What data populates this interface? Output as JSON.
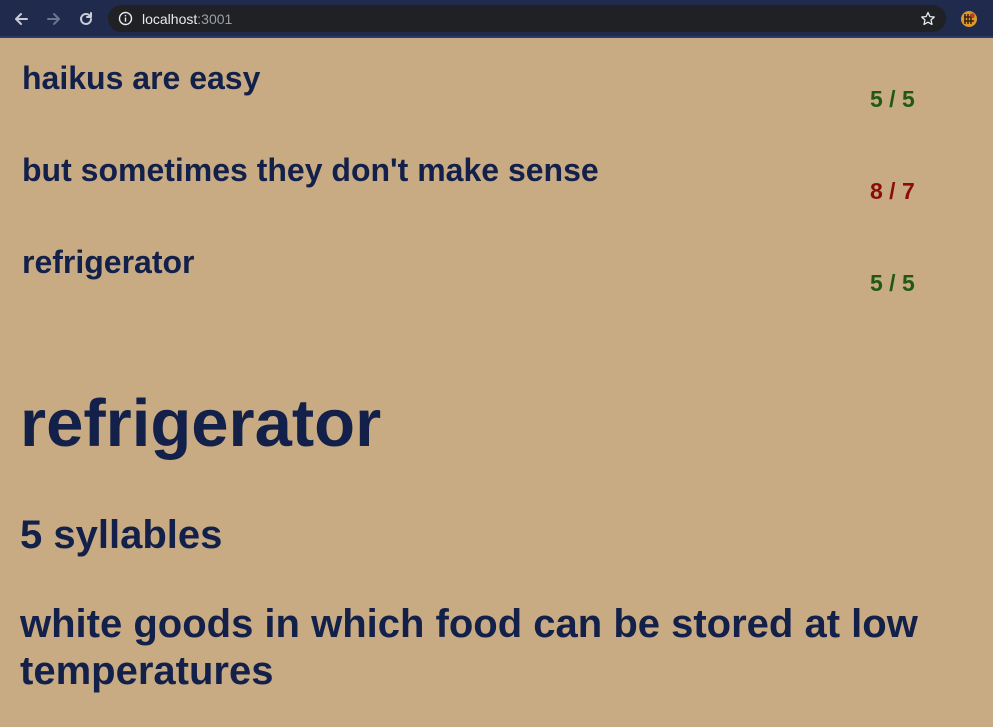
{
  "browser": {
    "url_host": "localhost",
    "url_port": ":3001",
    "icons": [
      "back-arrow-icon",
      "forward-arrow-icon",
      "reload-icon",
      "info-icon",
      "star-icon",
      "extension-icon"
    ]
  },
  "haiku": {
    "lines": [
      {
        "text": "haikus are easy",
        "count": "5 / 5",
        "status": "ok"
      },
      {
        "text": "but sometimes they don't make sense",
        "count": "8 / 7",
        "status": "over"
      },
      {
        "text": "refrigerator",
        "count": "5 / 5",
        "status": "ok"
      }
    ]
  },
  "detail": {
    "word": "refrigerator",
    "syllables": "5 syllables",
    "definition": "white goods in which food can be stored at low temperatures"
  },
  "colors": {
    "background": "#c8ab83",
    "text": "#13204a",
    "ok": "#1f5a10",
    "over": "#8b0d0b",
    "chrome": "#1f2a4d"
  }
}
